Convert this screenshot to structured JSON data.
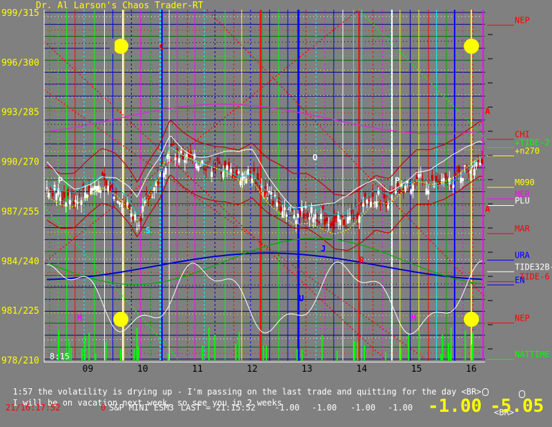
{
  "app": {
    "title": "Dr. Al Larson's Chaos Trader-RT"
  },
  "colors": {
    "background": "#808080",
    "up_bar": "#ffffff",
    "down_bar": "#cc0000",
    "y_label": "#ffff00",
    "x_label": "#000000",
    "message": "#ffffff",
    "timestamp": "#ff0000",
    "quote": "#ffffff",
    "big_value": "#ffff00"
  },
  "chart_data": {
    "type": "candlestick",
    "instrument": "S&P MINI ESM3",
    "y_axis": {
      "ticks": [
        {
          "value": 999.0,
          "label": "999/315"
        },
        {
          "value": 996.0,
          "label": "996/300"
        },
        {
          "value": 993.0,
          "label": "993/285"
        },
        {
          "value": 990.0,
          "label": "990/270"
        },
        {
          "value": 987.0,
          "label": "987/255"
        },
        {
          "value": 984.0,
          "label": "984/240"
        },
        {
          "value": 981.0,
          "label": "981/225"
        },
        {
          "value": 978.0,
          "label": "978/210"
        }
      ]
    },
    "x_axis": {
      "range": [
        8.2,
        16.25
      ],
      "start_label": "8:15",
      "ticks": [
        {
          "value": 9,
          "label": "09"
        },
        {
          "value": 10,
          "label": "10"
        },
        {
          "value": 11,
          "label": "11"
        },
        {
          "value": 12,
          "label": "12"
        },
        {
          "value": 13,
          "label": "13"
        },
        {
          "value": 14,
          "label": "14"
        },
        {
          "value": 15,
          "label": "15"
        },
        {
          "value": 16,
          "label": "16"
        }
      ]
    },
    "price_path": [
      [
        8.25,
        988.6
      ],
      [
        8.5,
        988.0
      ],
      [
        8.75,
        987.8
      ],
      [
        9.0,
        988.3
      ],
      [
        9.25,
        988.7
      ],
      [
        9.5,
        988.2
      ],
      [
        9.75,
        987.2
      ],
      [
        9.9,
        986.4
      ],
      [
        10.1,
        987.8
      ],
      [
        10.3,
        989.0
      ],
      [
        10.5,
        990.8
      ],
      [
        10.75,
        990.3
      ],
      [
        11.0,
        990.0
      ],
      [
        11.25,
        989.8
      ],
      [
        11.5,
        989.6
      ],
      [
        11.75,
        989.2
      ],
      [
        12.0,
        989.3
      ],
      [
        12.15,
        988.6
      ],
      [
        12.3,
        988.0
      ],
      [
        12.5,
        987.5
      ],
      [
        12.75,
        986.9
      ],
      [
        13.0,
        987.0
      ],
      [
        13.25,
        986.7
      ],
      [
        13.5,
        986.3
      ],
      [
        13.75,
        986.5
      ],
      [
        14.0,
        987.2
      ],
      [
        14.25,
        988.0
      ],
      [
        14.5,
        987.7
      ],
      [
        14.75,
        988.4
      ],
      [
        15.0,
        988.9
      ],
      [
        15.25,
        988.6
      ],
      [
        15.5,
        988.7
      ],
      [
        15.75,
        989.1
      ],
      [
        16.0,
        989.8
      ],
      [
        16.15,
        990.3
      ]
    ],
    "legend_labels": [
      {
        "text": "NEP",
        "color": "#ff0000",
        "value": 998.4
      },
      {
        "text": "CHI",
        "color": "#ff0000",
        "value": 991.5
      },
      {
        "text": "+TIDE-2",
        "color": "#00ff00",
        "value": 991.0
      },
      {
        "text": "+n270",
        "color": "#ffff00",
        "value": 990.5
      },
      {
        "text": "M090",
        "color": "#ffff00",
        "value": 988.6
      },
      {
        "text": "MER",
        "color": "#ff00ff",
        "value": 987.9
      },
      {
        "text": "PLU",
        "color": "#ffffff",
        "value": 987.5
      },
      {
        "text": "MAR",
        "color": "#ff0000",
        "value": 985.8
      },
      {
        "text": "URA",
        "color": "#0000ff",
        "value": 984.2
      },
      {
        "text": "TIDE32B-1",
        "color": "#ffffff",
        "value": 983.5
      },
      {
        "text": "-TIDE-6",
        "color": "#ff0000",
        "value": 982.9
      },
      {
        "text": "EN",
        "color": "#0000ff",
        "value": 982.7
      },
      {
        "text": "NEP",
        "color": "#ff0000",
        "value": 980.4
      },
      {
        "text": "NATTIME",
        "color": "#00ff00",
        "value": 978.2
      }
    ],
    "chart_letters": [
      {
        "text": "C",
        "color": "#ff0000",
        "x": 10.3,
        "y": 996.8
      },
      {
        "text": "A",
        "color": "#ff0000",
        "x": 16.25,
        "y": 992.9
      },
      {
        "text": "O",
        "color": "#ffffff",
        "x": 13.1,
        "y": 990.1
      },
      {
        "text": "P",
        "color": "#ffffff",
        "x": 8.45,
        "y": 988.7
      },
      {
        "text": "M",
        "color": "#ff0000",
        "x": 12.2,
        "y": 987.9
      },
      {
        "text": "P",
        "color": "#ffffff",
        "x": 14.6,
        "y": 988.7
      },
      {
        "text": "A",
        "color": "#ff0000",
        "x": 16.25,
        "y": 987.0
      },
      {
        "text": "S",
        "color": "#00ffff",
        "x": 10.05,
        "y": 985.7
      },
      {
        "text": "J",
        "color": "#0000ff",
        "x": 13.25,
        "y": 984.6
      },
      {
        "text": "R",
        "color": "#ff0000",
        "x": 13.95,
        "y": 983.9
      },
      {
        "text": "U",
        "color": "#0000ff",
        "x": 12.85,
        "y": 981.6
      },
      {
        "text": "M",
        "color": "#ff00ff",
        "x": 8.8,
        "y": 980.4
      },
      {
        "text": "M",
        "color": "#ff00ff",
        "x": 14.9,
        "y": 980.4
      }
    ],
    "moons": [
      {
        "x": 9.6,
        "y": 997.0
      },
      {
        "x": 16.0,
        "y": 997.0
      },
      {
        "x": 9.6,
        "y": 980.5
      },
      {
        "x": 16.0,
        "y": 980.5
      }
    ]
  },
  "messages": {
    "line1": "1:57 the volatility is drying up - I'm passing on the last trade and quitting for the day <BR>",
    "line2": "I will be on vacation next week, so see you in 2 weeks",
    "line2_suffix": "<BR>"
  },
  "status_bar": {
    "timestamp": "21/16:17:52",
    "zero": "0",
    "instrument": "S&P MINI ESM3",
    "last": "LAST = 21:15:52",
    "changes": [
      "-1.00",
      "-1.00",
      "-1.00",
      "-1.00"
    ],
    "big_change": "-1.00",
    "big_net": "-5.05"
  }
}
